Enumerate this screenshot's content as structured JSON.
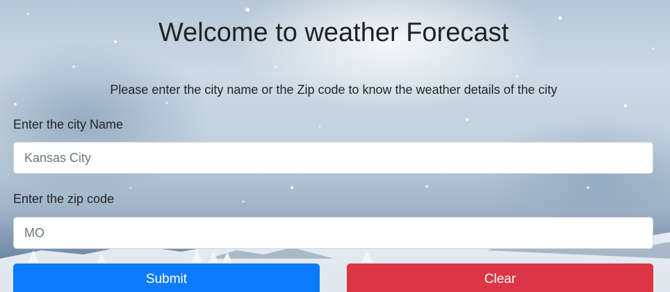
{
  "page": {
    "title": "Welcome to weather Forecast",
    "intro": "Please enter the city name or the Zip code to know the weather details of the city"
  },
  "form": {
    "city_label": "Enter the city Name",
    "city_placeholder": "Kansas City",
    "city_value": "",
    "zip_label": "Enter the zip code",
    "zip_placeholder": "MO",
    "zip_value": "",
    "submit_label": "Submit",
    "clear_label": "Clear"
  },
  "colors": {
    "submit_button": "#0d7bfe",
    "clear_button": "#dc3545",
    "title_text": "#1f2326"
  },
  "background": {
    "icon": "snowy-mountain-landscape"
  }
}
